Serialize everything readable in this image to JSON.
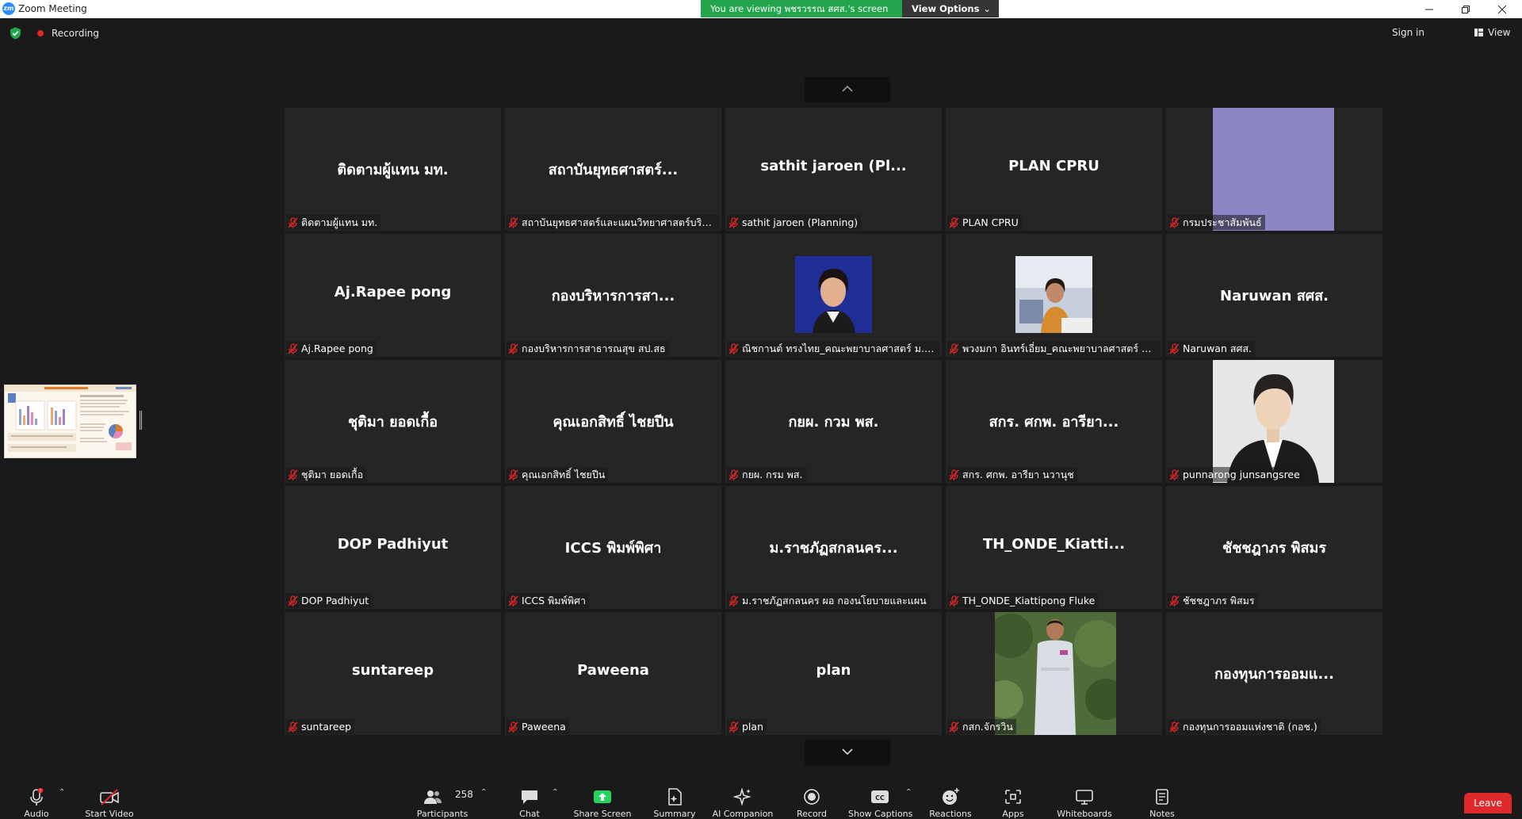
{
  "window": {
    "title": "Zoom Meeting",
    "icon_text": "zm",
    "controls": [
      "minimize-icon",
      "restore-icon",
      "close-icon"
    ]
  },
  "banner": {
    "viewing_text": "You are viewing พชรวรรณ สศส.'s screen",
    "view_options": "View Options"
  },
  "topbar": {
    "recording": "Recording",
    "sign_in": "Sign in",
    "view": "View"
  },
  "colors": {
    "banner_green": "#23a54e",
    "leave_red": "#e0292d",
    "share_screen_green": "#23d35f",
    "muted_red": "#e02828",
    "tile_bg": "#252525",
    "avatar_purple": "#8b86c6"
  },
  "tiles": [
    {
      "big": "ติดตามผู้แทน มท.",
      "label": "ติดตามผู้แทน มท."
    },
    {
      "big": "สถาบันยุทธศาสตร์...",
      "label": "สถาบันยุทธศาสตร์และแผนวิทยาศาสตร์บริการ กร..."
    },
    {
      "big": "sathit  jaroen (Pl...",
      "label": "sathit  jaroen (Planning)"
    },
    {
      "big": "PLAN CPRU",
      "label": "PLAN CPRU"
    },
    {
      "big": "",
      "label": "กรมประชาสัมพันธ์",
      "photo": "purple-avatar"
    },
    {
      "big": "Aj.Rapee pong",
      "label": "Aj.Rapee pong"
    },
    {
      "big": "กองบริหารการสา...",
      "label": "กองบริหารการสาธารณสุข สป.สธ"
    },
    {
      "big": "",
      "label": "ณิชกานต์ ทรงไทย_คณะพยาบาลศาสตร์ ม.นเรศวร",
      "photo": "woman-portrait"
    },
    {
      "big": "",
      "label": "พวงมกา อินทร์เอี่ยม_คณะพยาบาลศาสตร์ มรภ.อุ...",
      "photo": "woman-desk"
    },
    {
      "big": "Naruwan สศส.",
      "label": "Naruwan สศส."
    },
    {
      "big": "ชุติมา ยอดเกื้อ",
      "label": "ชุติมา ยอดเกื้อ"
    },
    {
      "big": "คุณเอกสิทธิ์ ไชยปีน",
      "label": "คุณเอกสิทธิ์ ไชยปีน"
    },
    {
      "big": "กยผ. กวม พส.",
      "label": "กยผ. กรม พส."
    },
    {
      "big": "สกร. ศกพ. อารียา...",
      "label": "สกร. ศกพ. อารียา นวานุช"
    },
    {
      "big": "",
      "label": "punnarong junsangsree",
      "photo": "man-portrait"
    },
    {
      "big": "DOP Padhiyut",
      "label": "DOP Padhiyut"
    },
    {
      "big": "ICCS พิมพ์พิศา",
      "label": "ICCS พิมพ์พิศา"
    },
    {
      "big": "ม.ราชภัฏสกลนคร...",
      "label": "ม.ราชภัฏสกลนคร  ผอ กองนโยบายและแผน"
    },
    {
      "big": "TH_ONDE_Kiatti...",
      "label": "TH_ONDE_Kiattipong Fluke"
    },
    {
      "big": "ชัชชฎาภร พิสมร",
      "label": "ชัชชฎาภร พิสมร"
    },
    {
      "big": "suntareep",
      "label": "suntareep"
    },
    {
      "big": "Paweena",
      "label": "Paweena"
    },
    {
      "big": "plan",
      "label": "plan"
    },
    {
      "big": "",
      "label": "กสก.จักรวิน",
      "photo": "man-uniform"
    },
    {
      "big": "กองทุนการออมแ...",
      "label": "กองทุนการออมแห่งชาติ (กอช.)"
    }
  ],
  "toolbar": {
    "audio": "Audio",
    "start_video": "Start Video",
    "participants": "Participants",
    "participant_count": "258",
    "chat": "Chat",
    "share_screen": "Share Screen",
    "summary": "Summary",
    "ai_companion": "AI Companion",
    "record": "Record",
    "show_captions": "Show Captions",
    "reactions": "Reactions",
    "apps": "Apps",
    "whiteboards": "Whiteboards",
    "notes": "Notes",
    "leave": "Leave"
  }
}
